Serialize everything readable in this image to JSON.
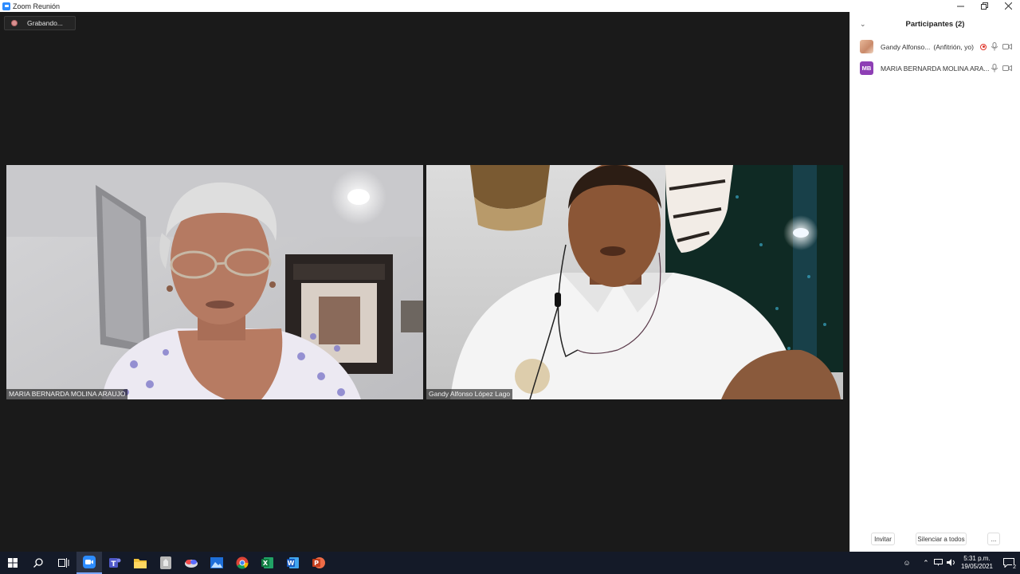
{
  "window": {
    "title": "Zoom Reunión"
  },
  "recording": {
    "label": "Grabando..."
  },
  "videos": [
    {
      "name": "MARIA BERNARDA MOLINA ARAUJO"
    },
    {
      "name": "Gandy Alfonso López Lago"
    }
  ],
  "participants_panel": {
    "title": "Participantes (2)",
    "participants": [
      {
        "name": "Gandy Alfonso...",
        "role": "(Anfitrión, yo)"
      },
      {
        "name": "MARIA BERNARDA MOLINA ARA...",
        "initials": "MB"
      }
    ],
    "invite_label": "Invitar",
    "mute_all_label": "Silenciar a todos",
    "more_label": "..."
  },
  "taskbar": {
    "time": "5:31 p.m.",
    "date": "19/05/2021",
    "notification_count": "2"
  },
  "colors": {
    "zoom_blue": "#2d8cff",
    "avatar_purple": "#8e3fb5",
    "recording_red": "#e0352b"
  }
}
